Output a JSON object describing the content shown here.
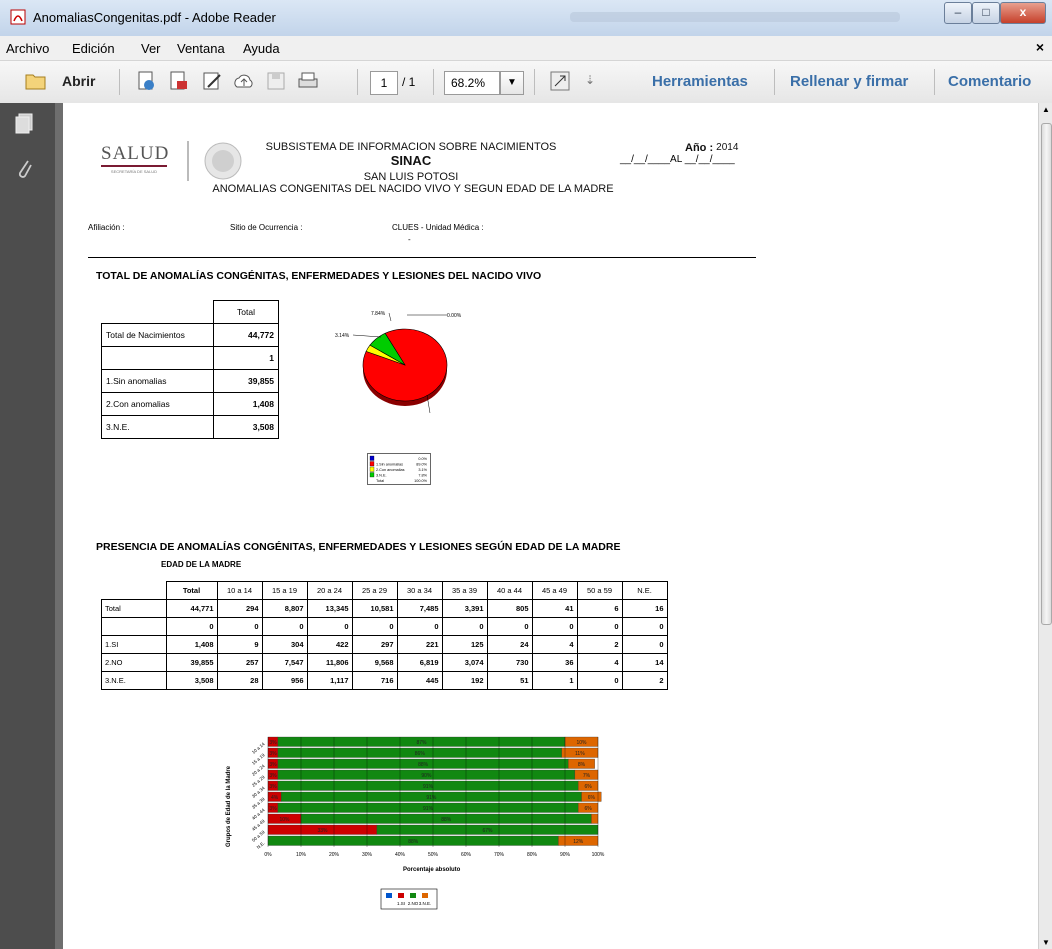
{
  "window": {
    "title": "AnomaliasCongenitas.pdf - Adobe Reader",
    "controls": {
      "minimize": "–",
      "maximize": "□",
      "close": "x"
    }
  },
  "menu": {
    "items": [
      "Archivo",
      "Edición",
      "Ver",
      "Ventana",
      "Ayuda"
    ],
    "close_doc": "×"
  },
  "toolbar": {
    "open_label": "Abrir",
    "page_current": "1",
    "page_total": "/ 1",
    "zoom": "68.2%",
    "more": "⇣",
    "tools_label": "Herramientas",
    "fill_sign_label": "Rellenar y firmar",
    "comment_label": "Comentario"
  },
  "doc": {
    "logo": {
      "name": "SALUD",
      "sub": "SECRETARÍA DE SALUD"
    },
    "header": {
      "line1": "SUBSISTEMA DE INFORMACION SOBRE NACIMIENTOS",
      "line2": "SINAC",
      "line3": "SAN LUIS POTOSI",
      "line4": "ANOMALIAS CONGENITAS  DEL NACIDO VIVO Y SEGUN EDAD DE LA MADRE"
    },
    "year": {
      "label": "Año :",
      "value": "2014",
      "range": "__/__/____AL __/__/____"
    },
    "filters": {
      "afiliacion": "Afiliación :",
      "sitio": "Sitio de Ocurrencia :",
      "clues": "CLUES - Unidad Médica :",
      "clues_value": "-"
    },
    "section1": {
      "title": "TOTAL DE ANOMALÍAS CONGÉNITAS, ENFERMEDADES Y LESIONES DEL NACIDO VIVO",
      "col_header": "Total",
      "rows": [
        {
          "label": "Total  de Nacimientos",
          "value": "44,772"
        },
        {
          "label": "",
          "value": "1"
        },
        {
          "label": "1.Sin anomalias",
          "value": "39,855"
        },
        {
          "label": "2.Con anomalias",
          "value": "1,408"
        },
        {
          "label": "3.N.E.",
          "value": "3,508"
        }
      ]
    },
    "section2": {
      "title": "PRESENCIA DE ANOMALÍAS CONGÉNITAS, ENFERMEDADES Y LESIONES SEGÚN EDAD DE LA MADRE",
      "subtitle": "EDAD DE LA MADRE",
      "headers": [
        "",
        "Total",
        "10 a 14",
        "15 a 19",
        "20 a 24",
        "25 a 29",
        "30 a 34",
        "35 a 39",
        "40 a 44",
        "45 a 49",
        "50 a 59",
        "N.E."
      ],
      "rows": [
        [
          "Total",
          "44,771",
          "294",
          "8,807",
          "13,345",
          "10,581",
          "7,485",
          "3,391",
          "805",
          "41",
          "6",
          "16"
        ],
        [
          "",
          "0",
          "0",
          "0",
          "0",
          "0",
          "0",
          "0",
          "0",
          "0",
          "0",
          "0"
        ],
        [
          "1.SI",
          "1,408",
          "9",
          "304",
          "422",
          "297",
          "221",
          "125",
          "24",
          "4",
          "2",
          "0"
        ],
        [
          "2.NO",
          "39,855",
          "257",
          "7,547",
          "11,806",
          "9,568",
          "6,819",
          "3,074",
          "730",
          "36",
          "4",
          "14"
        ],
        [
          "3.N.E.",
          "3,508",
          "28",
          "956",
          "1,117",
          "716",
          "445",
          "192",
          "51",
          "1",
          "0",
          "2"
        ]
      ]
    }
  },
  "chart_data": [
    {
      "type": "pie",
      "categories": [
        "",
        "1.Sin anomalias",
        "2.Con anomalias",
        "3.N.E."
      ],
      "values": [
        0.0,
        89.02,
        3.14,
        7.84
      ],
      "labels": [
        "0.00%",
        "89.02%",
        "3.14%",
        "7.84%"
      ],
      "colors": [
        "#0000cc",
        "#ff0000",
        "#ffff00",
        "#00cc00"
      ],
      "legend": [
        "",
        "1.Sin anomalias",
        "2.Con anomalias",
        "3.N.E.",
        "Total"
      ]
    },
    {
      "type": "bar",
      "orientation": "horizontal-stacked",
      "ylabel": "Grupos de Edad de la Madre",
      "xlabel": "Porcentaje absoluto",
      "categories": [
        "10 a 14",
        "15 a 19",
        "20 a 24",
        "25 a 29",
        "30 a 34",
        "35 a 39",
        "40 a 44",
        "45 a 49",
        "50 a 59",
        "N.E."
      ],
      "xticks": [
        "0%",
        "10%",
        "20%",
        "30%",
        "40%",
        "50%",
        "60%",
        "70%",
        "80%",
        "90%",
        "100%"
      ],
      "series": [
        {
          "name": "1.SI",
          "color": "#cc0000",
          "values": [
            3,
            3,
            3,
            3,
            3,
            4,
            3,
            10,
            33,
            0
          ]
        },
        {
          "name": "2.NO",
          "color": "#118811",
          "values": [
            87,
            86,
            88,
            90,
            91,
            91,
            91,
            88,
            67,
            88
          ]
        },
        {
          "name": "3.N.E.",
          "color": "#dd6600",
          "values": [
            10,
            11,
            8,
            7,
            6,
            6,
            6,
            2,
            0,
            12
          ]
        }
      ],
      "legend": [
        "",
        "1.SI",
        "2.NO",
        "3.N.E."
      ],
      "legend_colors": [
        "#0055cc",
        "#cc0000",
        "#118811",
        "#dd6600"
      ]
    }
  ]
}
